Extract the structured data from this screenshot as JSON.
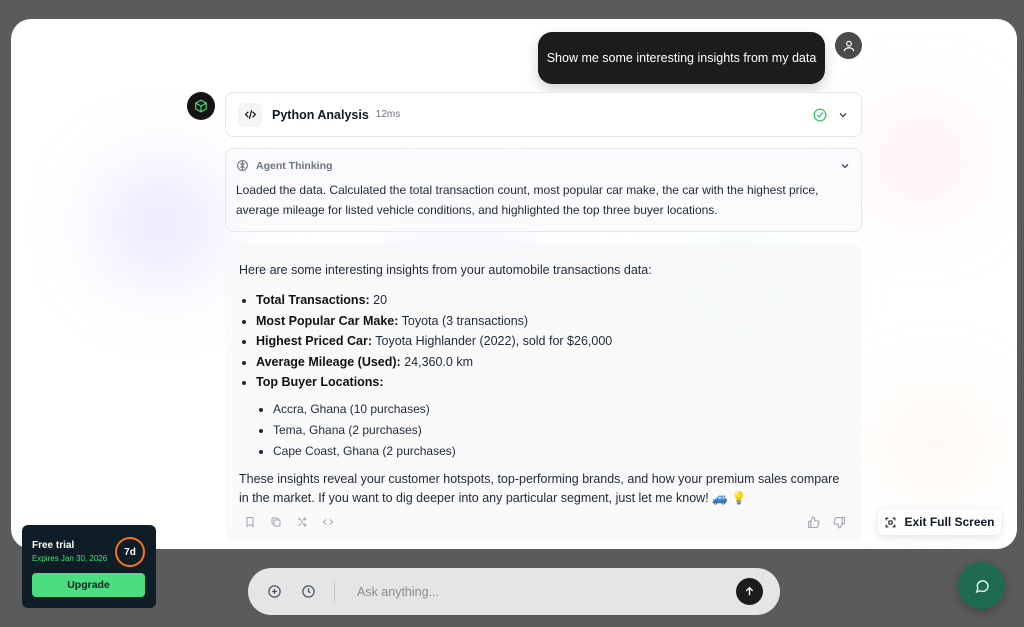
{
  "chat": {
    "user_message": "Show me some interesting insights from my data",
    "tool": {
      "title": "Python Analysis",
      "duration": "12ms"
    },
    "thinking": {
      "label": "Agent Thinking",
      "text": "Loaded the data. Calculated the total transaction count, most popular car make, the car with the highest price, average mileage for listed vehicle conditions, and highlighted the top three buyer locations."
    },
    "answer": {
      "intro": "Here are some interesting insights from your automobile transactions data:",
      "bullets": [
        {
          "label": "Total Transactions:",
          "value": " 20"
        },
        {
          "label": "Most Popular Car Make:",
          "value": " Toyota (3 transactions)"
        },
        {
          "label": "Highest Priced Car:",
          "value": " Toyota Highlander (2022), sold for $26,000"
        },
        {
          "label": "Average Mileage (Used):",
          "value": " 24,360.0 km"
        },
        {
          "label": "Top Buyer Locations:",
          "value": ""
        }
      ],
      "locations": [
        "Accra, Ghana (10 purchases)",
        "Tema, Ghana (2 purchases)",
        "Cape Coast, Ghana (2 purchases)"
      ],
      "outro": "These insights reveal your customer hotspots, top-performing brands, and how your premium sales compare in the market. If you want to dig deeper into any particular segment, just let me know! 🚙 💡"
    }
  },
  "fullscreen": {
    "exit_label": "Exit Full Screen"
  },
  "trial": {
    "title": "Free trial",
    "expires": "Expires Jan 30, 2026",
    "days_left": "7d",
    "upgrade_label": "Upgrade"
  },
  "composer": {
    "placeholder": "Ask anything..."
  },
  "colors": {
    "accent_green": "#4ade80",
    "trial_ring": "#f97316",
    "fab": "#1f6b52",
    "check": "#22c55e"
  }
}
